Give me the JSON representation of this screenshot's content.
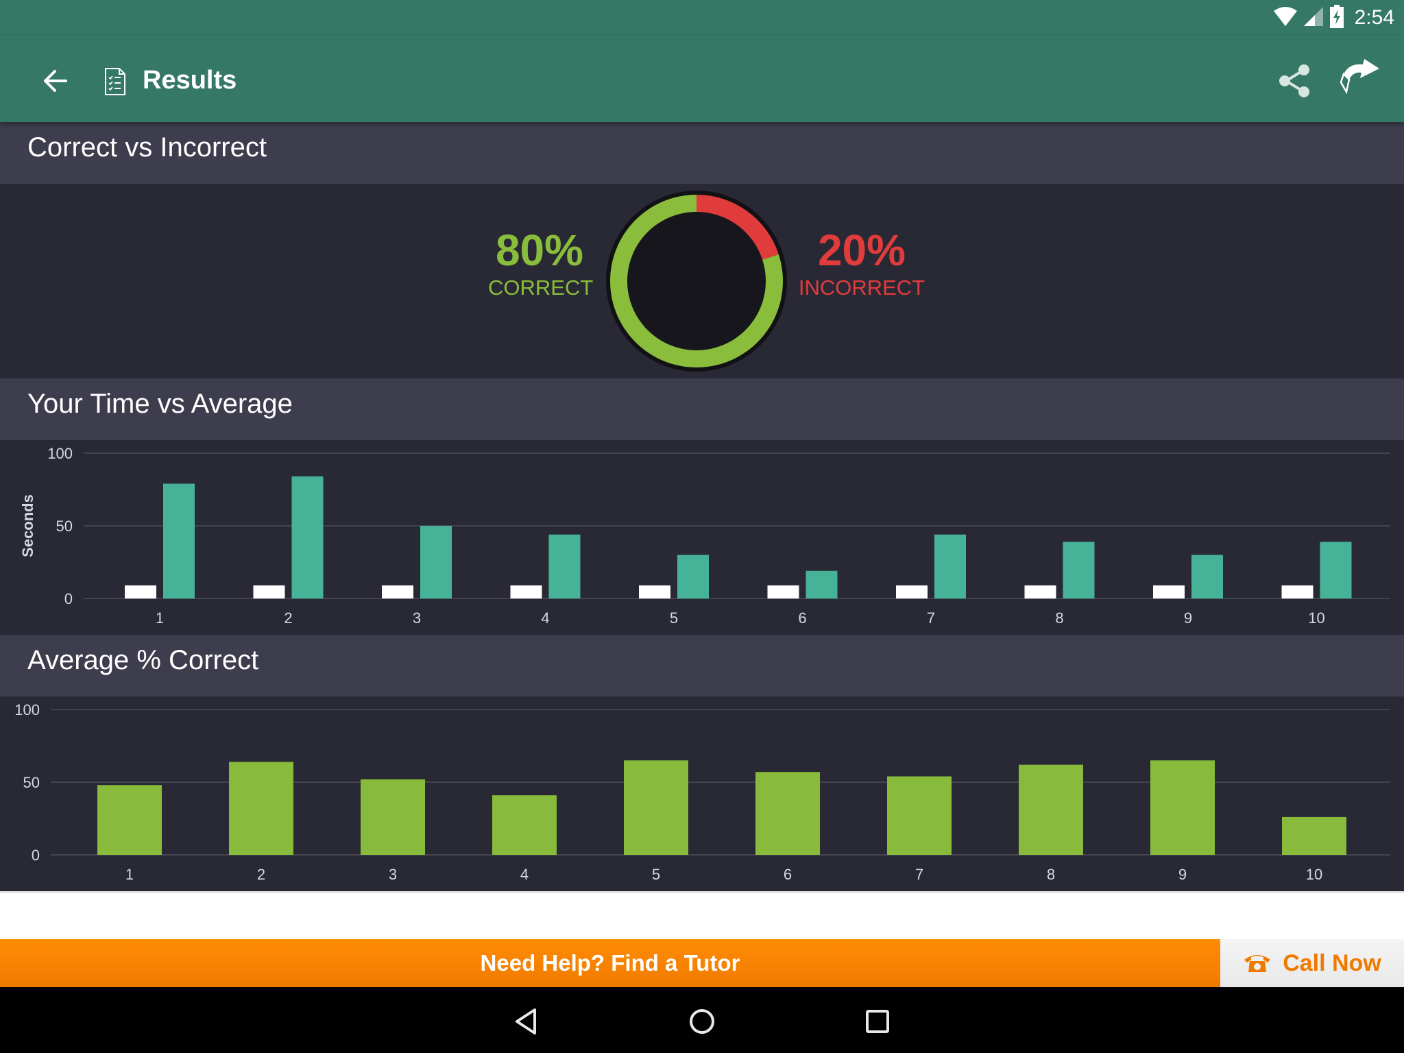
{
  "status_bar": {
    "time": "2:54",
    "icons": [
      "wifi-icon",
      "cell-signal-icon",
      "battery-charging-icon"
    ]
  },
  "toolbar": {
    "title": "Results",
    "icons": [
      "back-arrow-icon",
      "document-checklist-icon",
      "share-icon",
      "forward-arrow-icon"
    ]
  },
  "sections": {
    "correct_vs_incorrect": {
      "title": "Correct vs Incorrect"
    },
    "time_vs_average": {
      "title": "Your Time vs Average"
    },
    "average_correct": {
      "title": "Average % Correct"
    }
  },
  "summary": {
    "correct": {
      "percent_label": "80%",
      "label": "CORRECT",
      "color": "#8abd3b"
    },
    "incorrect": {
      "percent_label": "20%",
      "label": "INCORRECT",
      "color": "#e03c3c"
    }
  },
  "chart_data": [
    {
      "type": "pie",
      "title": "Correct vs Incorrect",
      "categories": [
        "Correct",
        "Incorrect"
      ],
      "values": [
        80,
        20
      ],
      "colors": [
        "#8abd3b",
        "#e03c3c"
      ],
      "donut": true
    },
    {
      "type": "bar",
      "title": "Your Time vs Average",
      "xlabel": "",
      "ylabel": "Seconds",
      "categories": [
        "1",
        "2",
        "3",
        "4",
        "5",
        "6",
        "7",
        "8",
        "9",
        "10"
      ],
      "series": [
        {
          "name": "Your Time",
          "color": "#ffffff",
          "values": [
            9,
            9,
            9,
            9,
            9,
            9,
            9,
            9,
            9,
            9
          ]
        },
        {
          "name": "Average",
          "color": "#46b396",
          "values": [
            79,
            84,
            50,
            44,
            30,
            19,
            44,
            39,
            30,
            39
          ]
        }
      ],
      "ylim": [
        0,
        100
      ],
      "yticks": [
        0,
        50,
        100
      ],
      "grid": true,
      "legend": "none"
    },
    {
      "type": "bar",
      "title": "Average % Correct",
      "xlabel": "",
      "ylabel": "",
      "categories": [
        "1",
        "2",
        "3",
        "4",
        "5",
        "6",
        "7",
        "8",
        "9",
        "10"
      ],
      "values": [
        48,
        64,
        52,
        41,
        65,
        57,
        54,
        62,
        65,
        26
      ],
      "color": "#88bb3b",
      "ylim": [
        0,
        100
      ],
      "yticks": [
        0,
        50,
        100
      ],
      "grid": true,
      "legend": "none"
    }
  ],
  "footer": {
    "tutor_label": "Need Help? Find a Tutor",
    "call_label": "Call Now",
    "call_icon": "phone-icon"
  },
  "nav_bar": {
    "icons": [
      "nav-back-icon",
      "nav-home-icon",
      "nav-recents-icon"
    ]
  }
}
